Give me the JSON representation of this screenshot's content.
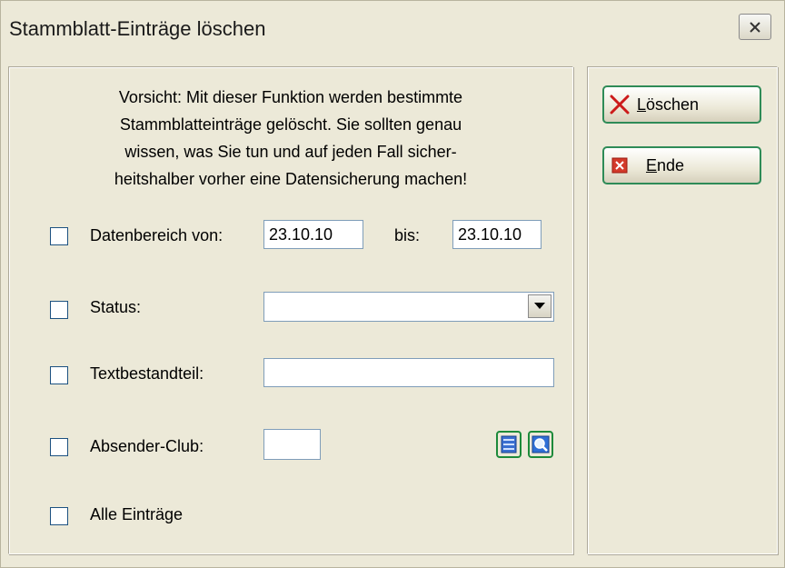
{
  "window": {
    "title": "Stammblatt-Einträge löschen"
  },
  "warning_lines": [
    "Vorsicht: Mit dieser Funktion werden bestimmte",
    "Stammblatteinträge gelöscht. Sie sollten genau",
    "wissen, was Sie tun und auf jeden Fall sicher-",
    "heitshalber vorher eine Datensicherung machen!"
  ],
  "filters": {
    "date_range": {
      "label": "Datenbereich von:",
      "checked": false,
      "from": "23.10.10",
      "to_label": "bis:",
      "to": "23.10.10"
    },
    "status": {
      "label": "Status:",
      "checked": false,
      "value": ""
    },
    "text_part": {
      "label": "Textbestandteil:",
      "checked": false,
      "value": ""
    },
    "sender_club": {
      "label": "Absender-Club:",
      "checked": false,
      "value": ""
    },
    "all_entries": {
      "label": "Alle Einträge",
      "checked": false
    }
  },
  "buttons": {
    "delete": {
      "mnemonic": "L",
      "rest": "öschen"
    },
    "end": {
      "mnemonic": "E",
      "rest": "nde"
    }
  },
  "colors": {
    "window_bg": "#ece9d8",
    "button_border": "#2e8b57",
    "delete_icon": "#cc1a1a",
    "end_icon": "#d33a2a"
  },
  "icons": {
    "close": "close-icon",
    "delete": "red-x-icon",
    "end": "exit-icon",
    "list": "list-icon",
    "search": "magnifier-icon",
    "dropdown": "dropdown-arrow-icon"
  }
}
